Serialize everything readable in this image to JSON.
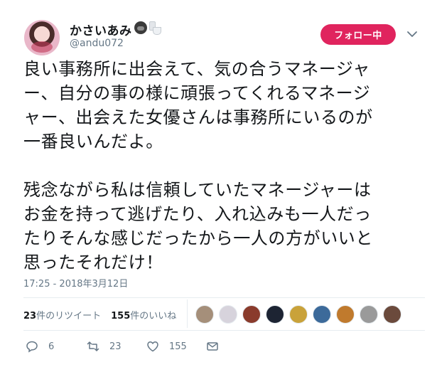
{
  "user": {
    "display_name": "かさいあみ",
    "handle": "@andu072",
    "name_emoji": [
      "gorilla-icon",
      "toilet-icon"
    ]
  },
  "follow_button": {
    "label": "フォロー中"
  },
  "tweet": {
    "paragraphs": [
      [
        "良い事務所に出会えて、気の合うマネージャ",
        "ー、自分の事の様に頑張ってくれるマネージ",
        "ャー、出会えた女優さんは事務所にいるのが",
        "一番良いんだよ。"
      ],
      [
        "残念ながら私は信頼していたマネージャーは",
        "お金を持って逃げたり、入れ込みも一人だっ",
        "たりそんな感じだったから一人の方がいいと",
        "思ったそれだけ！"
      ]
    ],
    "timestamp": "17:25 - 2018年3月12日"
  },
  "stats": {
    "retweets_count": "23",
    "retweets_label": "件のリツイート",
    "likes_count": "155",
    "likes_label": "件のいいね"
  },
  "likers": [
    {
      "color": "#a58f7a"
    },
    {
      "color": "#d7d3dc"
    },
    {
      "color": "#8a3b2c"
    },
    {
      "color": "#1d2433"
    },
    {
      "color": "#c9a23a"
    },
    {
      "color": "#3c6a9a"
    },
    {
      "color": "#c07a2d"
    },
    {
      "color": "#9a9a9a"
    },
    {
      "color": "#6b4a3c"
    }
  ],
  "actions": {
    "reply_count": "6",
    "retweet_count": "23",
    "like_count": "155"
  },
  "colors": {
    "accent": "#e0245e",
    "text": "#14171a",
    "secondary": "#657786",
    "border": "#e6ecf0"
  }
}
